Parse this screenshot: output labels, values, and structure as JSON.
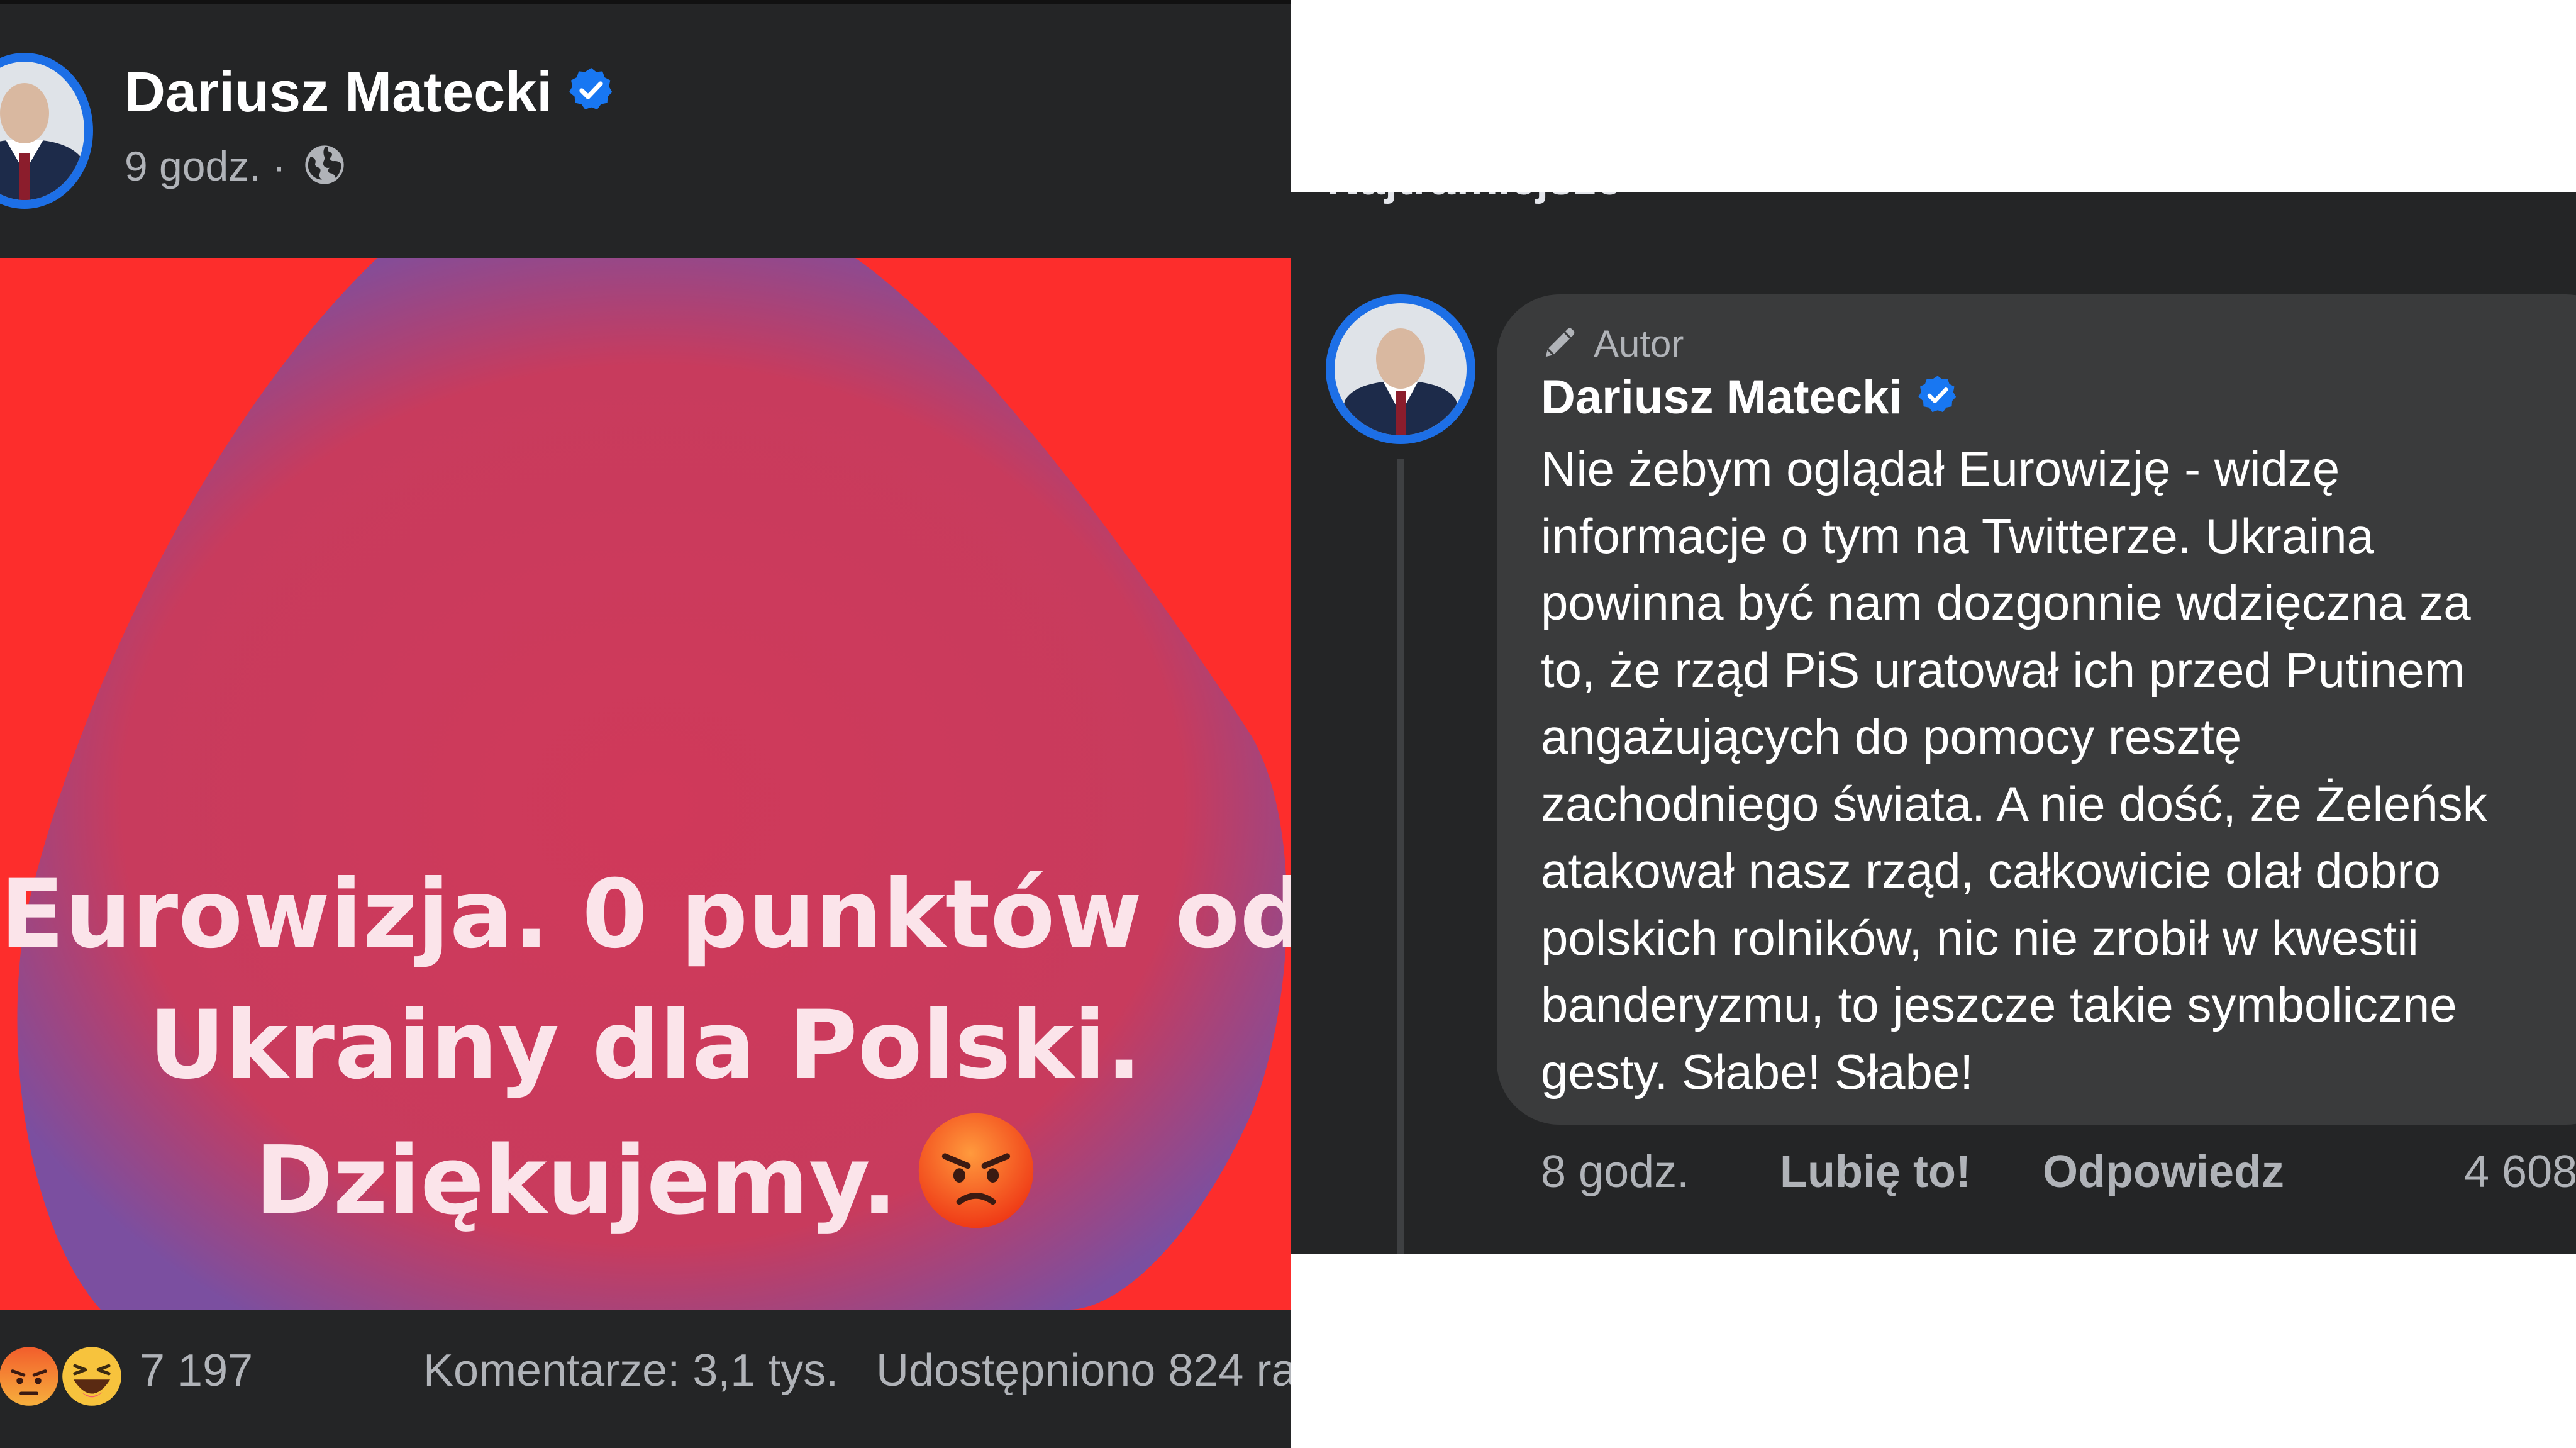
{
  "post": {
    "author": "Dariusz Matecki",
    "time": "9 godz.",
    "separator": "·",
    "audience_icon": "globe-icon",
    "image_text_lines": [
      "Eurowizja. 0 punktów od",
      "Ukrainy dla Polski.",
      "Dziękujemy."
    ],
    "image_emoji": "angry-face-emoji",
    "reaction_icons": [
      "angry-reaction",
      "haha-reaction"
    ],
    "reaction_count": "7 197",
    "comments": "Komentarze: 3,1 tys.",
    "shares": "Udostępniono 824 ra"
  },
  "comments_panel": {
    "sort_label": "Najtrafniejsze"
  },
  "comment": {
    "author_tag": "Autor",
    "author": "Dariusz Matecki",
    "text_lines": [
      "Nie żebym oglądał Eurowizję - widzę",
      "informacje o tym na Twitterze. Ukraina",
      "powinna być nam dozgonnie wdzięczna za",
      "to, że rząd PiS uratował ich przed Putinem",
      "angażujących do pomocy resztę",
      "zachodniego świata. A nie dość, że Żeleńsk",
      "atakował nasz rząd, całkowicie olał dobro",
      "polskich rolników, nic nie zrobił w kwestii",
      "banderyzmu, to jeszcze takie symboliczne",
      "gesty. Słabe! Słabe!"
    ],
    "time": "8 godz.",
    "like_label": "Lubię to!",
    "reply_label": "Odpowiedz",
    "reaction_count": "4 608"
  },
  "colors": {
    "panel_bg": "#242526",
    "bubble_bg": "#3a3b3c",
    "avatar_ring": "#1d6fe6",
    "verified": "#1877f2",
    "image_red": "#fd2d2c",
    "image_blob": "#c93b5e",
    "image_text": "#fbe4ea"
  }
}
